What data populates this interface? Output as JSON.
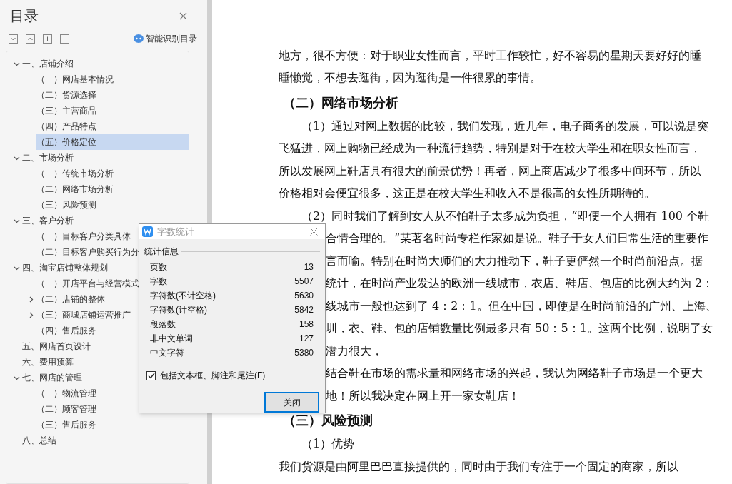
{
  "toc": {
    "title": "目录",
    "smart_button": "智能识别目录",
    "items": [
      {
        "label": "一、店铺介绍",
        "expanded": true,
        "selected": false,
        "children": [
          {
            "label": "（一）网店基本情况",
            "selected": false
          },
          {
            "label": "（二）货源选择",
            "selected": false
          },
          {
            "label": "（三）主营商品",
            "selected": false
          },
          {
            "label": "（四）产品特点",
            "selected": false
          },
          {
            "label": "（五）价格定位",
            "selected": true
          }
        ]
      },
      {
        "label": "二、市场分析",
        "expanded": true,
        "selected": false,
        "children": [
          {
            "label": "（一）传统市场分析",
            "selected": false
          },
          {
            "label": "（二）网络市场分析",
            "selected": false
          },
          {
            "label": "（三）风险预测",
            "selected": false
          }
        ]
      },
      {
        "label": "三、客户分析",
        "expanded": true,
        "selected": false,
        "children": [
          {
            "label": "（一）目标客户分类具体",
            "selected": false
          },
          {
            "label": "（二）目标客户购买行为分",
            "selected": false
          }
        ]
      },
      {
        "label": "四、淘宝店铺整体规划",
        "expanded": true,
        "selected": false,
        "children": [
          {
            "label": "（一）开店平台与经营模式",
            "selected": false
          },
          {
            "label": "（二）店铺的整体",
            "expanded": false,
            "selected": false
          },
          {
            "label": "（三）商城店铺运营推广",
            "expanded": false,
            "selected": false
          },
          {
            "label": "（四）售后服务",
            "selected": false
          }
        ]
      },
      {
        "label": "五、网店首页设计",
        "selected": false
      },
      {
        "label": "六、费用预算",
        "selected": false
      },
      {
        "label": "七、网店的管理",
        "expanded": true,
        "selected": false,
        "children": [
          {
            "label": "（一）物流管理",
            "selected": false
          },
          {
            "label": "（二）顾客管理",
            "selected": false
          },
          {
            "label": "（三）售后服务",
            "selected": false
          }
        ]
      },
      {
        "label": "八、总结",
        "selected": false
      }
    ]
  },
  "document": {
    "blocks": [
      {
        "kind": "line",
        "text": "地方，很不方便：对于职业女性而言，平时工作较忙，好不容易的星期天要好好的睡"
      },
      {
        "kind": "line",
        "text": "睡懒觉，不想去逛街，因为逛街是一件很累的事情。"
      },
      {
        "kind": "heading",
        "text": "（二）网络市场分析"
      },
      {
        "kind": "indent",
        "text": "（1）通过对网上数据的比较，我们发现，近几年，电子商务的发展，可以说是突"
      },
      {
        "kind": "line",
        "text": "飞猛进，网上购物已经成为一种流行趋势，特别是对于在校大学生和在职女性而言，"
      },
      {
        "kind": "line",
        "text": "所以发展网上鞋店具有很大的前景优势！再者，网上商店减少了很多中间环节，所以"
      },
      {
        "kind": "line",
        "text": "价格相对会便宜很多，这正是在校大学生和收入不是很高的女性所期待的。"
      },
      {
        "kind": "indent",
        "text": "（2）同时我们了解到女人从不怕鞋子太多成为负担，“即便一个人拥有 100 个鞋"
      },
      {
        "kind": "covered",
        "text": "合情合理的。”某著名时尚专栏作家如是说。鞋子于女人们日常生活的重要作"
      },
      {
        "kind": "covered",
        "text": "言而喻。特别在时尚大师们的大力推动下，鞋子更俨然一个时尚前沿点。据"
      },
      {
        "kind": "covered",
        "text": "统计，在时尚产业发达的欧洲一线城市，衣店、鞋店、包店的比例大约为 2："
      },
      {
        "kind": "covered",
        "text": "线城市一般也达到了 4：2：1。但在中国，即使是在时尚前沿的广州、上海、"
      },
      {
        "kind": "covered",
        "text": "圳，衣、鞋、包的店铺数量比例最多只有 50：5：1。这两个比例，说明了女"
      },
      {
        "kind": "covered",
        "text": "潜力很大，"
      },
      {
        "kind": "covered",
        "text": "结合鞋在市场的需求量和网络市场的兴起，我认为网络鞋子市场是一个更大"
      },
      {
        "kind": "covered",
        "text": "地！所以我决定在网上开一家女鞋店！"
      },
      {
        "kind": "heading",
        "text": "（三）风险预测"
      },
      {
        "kind": "indent",
        "text": "（1）优势"
      },
      {
        "kind": "line",
        "text": "我们货源是由阿里巴巴直接提供的，同时由于我们专注于一个固定的商家，所以"
      }
    ]
  },
  "dialog": {
    "title": "字数统计",
    "group": "统计信息",
    "stats": [
      {
        "label": "页数",
        "value": "13"
      },
      {
        "label": "字数",
        "value": "5507"
      },
      {
        "label": "字符数(不计空格)",
        "value": "5630"
      },
      {
        "label": "字符数(计空格)",
        "value": "5842"
      },
      {
        "label": "段落数",
        "value": "158"
      },
      {
        "label": "非中文单词",
        "value": "127"
      },
      {
        "label": "中文字符",
        "value": "5380"
      }
    ],
    "checkbox": {
      "label": "包括文本框、脚注和尾注(F)",
      "checked": true
    },
    "button": "关闭"
  }
}
